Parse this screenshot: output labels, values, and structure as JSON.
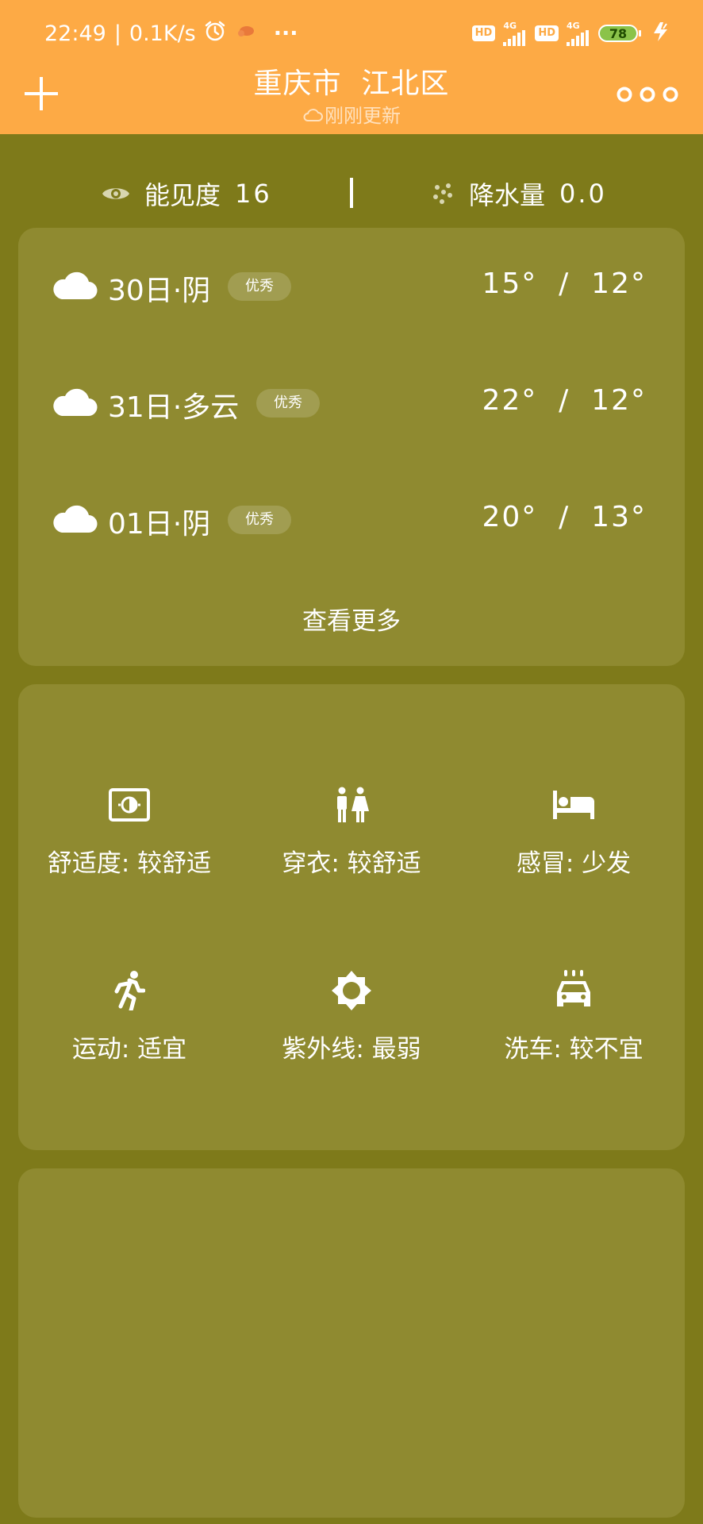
{
  "status_bar": {
    "time": "22:49",
    "speed": "0.1K/s",
    "more": "···",
    "hd1": "HD",
    "sig1": "4G",
    "hd2": "HD",
    "sig2": "4G",
    "battery": "78"
  },
  "header": {
    "city": "重庆市  江北区",
    "updated": "刚刚更新"
  },
  "metrics": {
    "visibility_label": "能见度",
    "visibility_value": "16",
    "precip_label": "降水量",
    "precip_value": "0.0"
  },
  "forecast": {
    "days": [
      {
        "date": "30日·阴",
        "aqi": "优秀",
        "temp": "15°  /  12°"
      },
      {
        "date": "31日·多云",
        "aqi": "优秀",
        "temp": "22°  /  12°"
      },
      {
        "date": "01日·阴",
        "aqi": "优秀",
        "temp": "20°  /  13°"
      }
    ],
    "more": "查看更多"
  },
  "life": {
    "comfort": "舒适度:  较舒适",
    "dressing": "穿衣:  较舒适",
    "cold": "感冒:  少发",
    "sport": "运动:  适宜",
    "uv": "紫外线:  最弱",
    "carwash": "洗车:  较不宜"
  },
  "colors": {
    "header": "#fdaa45",
    "background": "#7e7a1a",
    "card": "#8f8a30"
  }
}
